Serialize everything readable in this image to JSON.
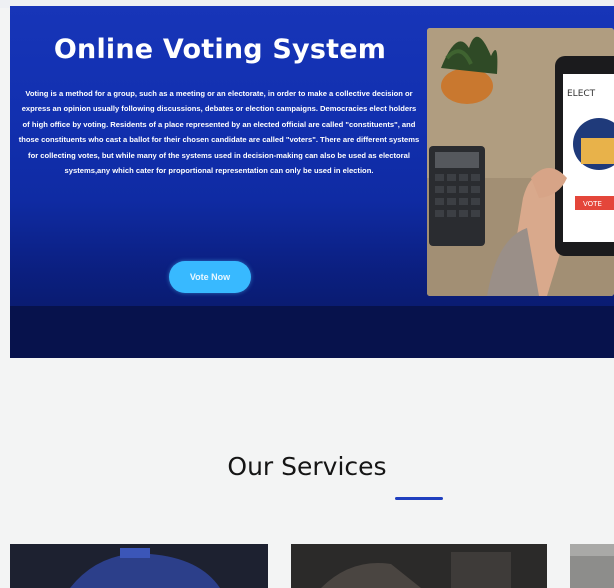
{
  "hero": {
    "title": "Online Voting System",
    "description": "Voting is a method for a group, such as a meeting or an electorate, in order to make a collective decision or express an opinion usually following discussions, debates or election campaigns. Democracies elect holders of high office by voting. Residents of a place represented by an elected official are called \"constituents\", and those constituents who cast a ballot for their chosen candidate are called \"voters\". There are different systems for collecting votes, but while many of the systems used in decision-making can also be used as electoral systems,any which cater for proportional representation can only be used in election.",
    "vote_button_label": "Vote Now",
    "photo": {
      "phone_screen_heading": "ELECT",
      "phone_screen_button": "VOTE"
    }
  },
  "services": {
    "title": "Our Services"
  },
  "colors": {
    "hero_blue": "#1230b0",
    "button_cyan": "#38b9ff",
    "accent_underline": "#1f3fbf"
  }
}
